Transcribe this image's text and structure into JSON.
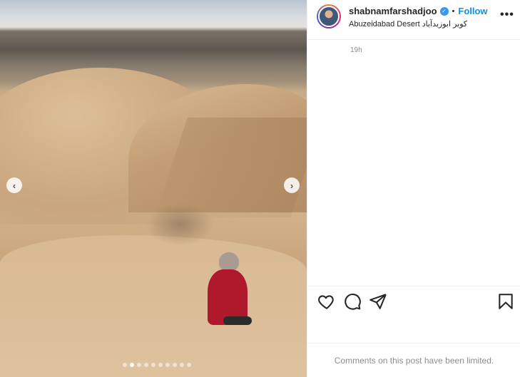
{
  "post": {
    "carousel": {
      "slide_count": 10,
      "active_slide_index": 1,
      "prev_icon": "chevron-left-icon",
      "next_icon": "chevron-right-icon",
      "prev_glyph": "‹",
      "next_glyph": "›"
    },
    "header": {
      "username": "shabnamfarshadjoo",
      "verified_glyph": "✓",
      "separator": "•",
      "follow_label": "Follow",
      "location": "Abuzeidabad Desert کویر ابوزیدآباد",
      "more_glyph": "•••"
    },
    "timestamp": "19h",
    "actions": {
      "like_icon": "heart-icon",
      "comment_icon": "comment-icon",
      "share_icon": "paper-plane-icon",
      "save_icon": "bookmark-icon"
    },
    "comments_notice": "Comments on this post have been limited."
  },
  "colors": {
    "accent": "#0095f6",
    "verified": "#3897f0",
    "muted_text": "#8e8e8e",
    "jacket": "#b0182c"
  }
}
